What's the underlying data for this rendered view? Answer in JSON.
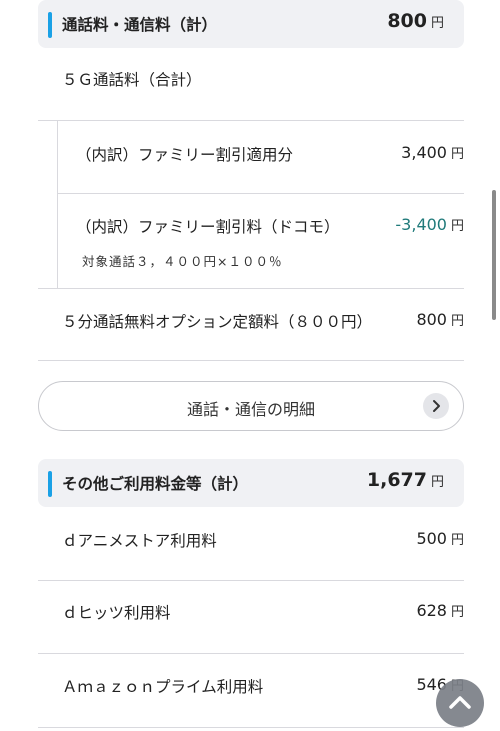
{
  "call_section": {
    "title": "通話料・通信料（計）",
    "amount": "800",
    "unit": "円",
    "subheading": "５Ｇ通話料（合計）",
    "breakdown": [
      {
        "label": "（内訳）ファミリー割引適用分",
        "value": "3,400",
        "unit": "円"
      },
      {
        "label": "（内訳）ファミリー割引料（ドコモ）",
        "value": "-3,400",
        "unit": "円",
        "note": "対象通話３，４００円×１００％"
      }
    ],
    "option": {
      "label": "５分通話無料オプション定額料（８００円）",
      "value": "800",
      "unit": "円"
    }
  },
  "detail_button": {
    "label": "通話・通信の明細"
  },
  "other_section": {
    "title": "その他ご利用料金等（計）",
    "amount": "1,677",
    "unit": "円",
    "items": [
      {
        "label": "ｄアニメストア利用料",
        "value": "500",
        "unit": "円"
      },
      {
        "label": "ｄヒッツ利用料",
        "value": "628",
        "unit": "円"
      },
      {
        "label": "Ａｍａｚｏｎプライム利用料",
        "value": "546",
        "unit": "円"
      }
    ]
  },
  "colors": {
    "accent": "#1aa1e6",
    "negative": "#1f7a7a",
    "header_bg": "#f0f1f4"
  },
  "icons": {
    "detail_button": "chevron-right-icon",
    "scroll_top": "chevron-up-icon"
  }
}
